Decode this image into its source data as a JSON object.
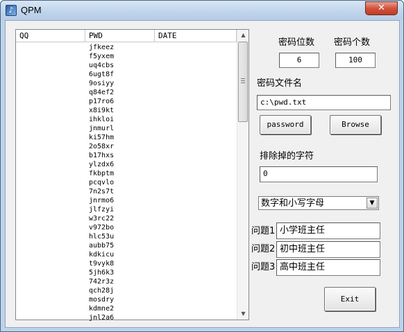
{
  "window": {
    "title": "QPM",
    "icon": "app-icon",
    "close_glyph": "✕"
  },
  "list": {
    "columns": [
      "QQ",
      "PWD",
      "DATE"
    ],
    "passwords": [
      "jfkeez",
      "f5yxem",
      "uq4cbs",
      "6ugt8f",
      "9osiyy",
      "q84ef2",
      "p17ro6",
      "x8i9kt",
      "ihkloi",
      "jnmurl",
      "ki57hm",
      "2o58xr",
      "b17hxs",
      "ylzdx6",
      "fkbptm",
      "pcqvlo",
      "7n2s7t",
      "jnrmo6",
      "jlfzyi",
      "w3rc22",
      "v972bo",
      "hlc53u",
      "aubb75",
      "kdkicu",
      "t9vyk8",
      "5jh6k3",
      "742r3z",
      "qch28j",
      "mosdry",
      "kdmne2",
      "jnl2a6"
    ]
  },
  "settings": {
    "length_label": "密码位数",
    "length_value": "6",
    "count_label": "密码个数",
    "count_value": "100",
    "file_label": "密码文件名",
    "file_value": "c:\\pwd.txt",
    "password_button": "password",
    "browse_button": "Browse",
    "exclude_label": "排除掉的字符",
    "exclude_value": "0",
    "charset_selected": "数字和小写字母",
    "q1_label": "问题1",
    "q1_value": "小学班主任",
    "q2_label": "问题2",
    "q2_value": "初中班主任",
    "q3_label": "问题3",
    "q3_value": "高中班主任",
    "exit_button": "Exit"
  }
}
